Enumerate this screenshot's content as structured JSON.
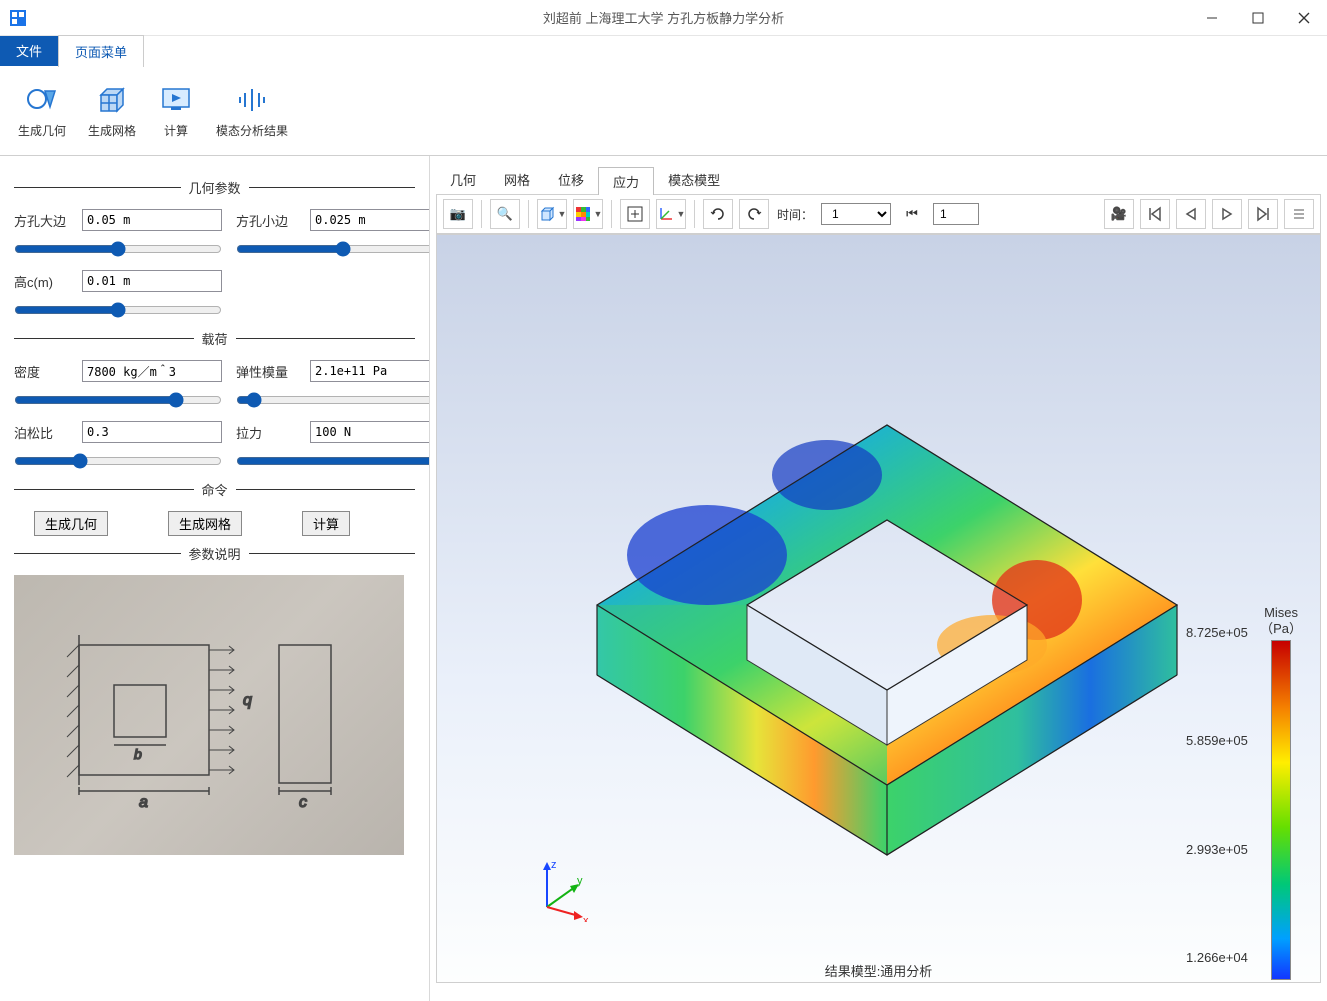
{
  "window": {
    "title": "刘超前   上海理工大学  方孔方板静力学分析"
  },
  "tabs": {
    "file": "文件",
    "page_menu": "页面菜单"
  },
  "ribbon": {
    "gen_geometry": "生成几何",
    "gen_mesh": "生成网格",
    "compute": "计算",
    "modal_result": "模态分析结果"
  },
  "left": {
    "section_geometry": "几何参数",
    "section_load": "载荷",
    "section_cmd": "命令",
    "section_desc": "参数说明",
    "labels": {
      "big_edge": "方孔大边",
      "small_edge": "方孔小边",
      "height": "高c(m)",
      "density": "密度",
      "elastic": "弹性模量",
      "poisson": "泊松比",
      "tension": "拉力"
    },
    "values": {
      "big_edge": "0.05 m",
      "small_edge": "0.025 m",
      "height": "0.01 m",
      "density": "7800 kg／m＾3",
      "elastic": "2.1e+11 Pa",
      "poisson": "0.3",
      "tension": "100 N"
    },
    "buttons": {
      "gen_geometry": "生成几何",
      "gen_mesh": "生成网格",
      "compute": "计算"
    }
  },
  "right": {
    "tabs": {
      "geometry": "几何",
      "mesh": "网格",
      "displacement": "位移",
      "stress": "应力",
      "modal": "模态模型"
    },
    "time_label": "时间：",
    "time_value": "1",
    "frame_value": "1",
    "footer": "结果模型:通用分析",
    "colorbar": {
      "title1": "Mises",
      "title2": "（Pa）",
      "ticks": [
        "8.725e+05",
        "5.859e+05",
        "2.993e+05",
        "1.266e+04"
      ]
    }
  }
}
